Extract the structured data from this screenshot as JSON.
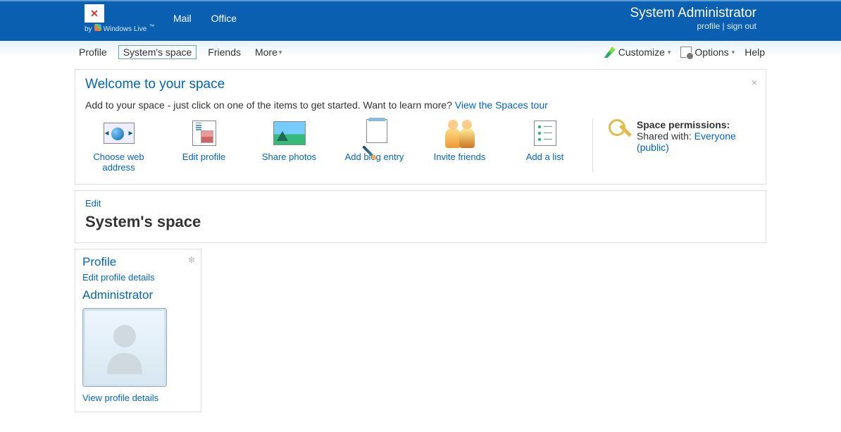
{
  "header": {
    "by": "by",
    "brand": "Windows Live",
    "tm": "™",
    "links": {
      "mail": "Mail",
      "office": "Office"
    },
    "user": {
      "name": "System Administrator",
      "profile": "profile",
      "sep": " | ",
      "signout": "sign out"
    }
  },
  "nav": {
    "profile": "Profile",
    "space": "System's space",
    "friends": "Friends",
    "more": "More",
    "customize": "Customize",
    "options": "Options",
    "help": "Help"
  },
  "welcome": {
    "title": "Welcome to your space",
    "intro": "Add to your space - just click on one of the items to get started. Want to learn more? ",
    "tour": "View the Spaces tour",
    "tiles": {
      "web": "Choose web address",
      "edit": "Edit profile",
      "photos": "Share photos",
      "blog": "Add blog entry",
      "invite": "Invite friends",
      "list": "Add a list"
    },
    "perm": {
      "heading": "Space permissions:",
      "shared": "Shared with: ",
      "value": "Everyone (public)"
    }
  },
  "space": {
    "edit": "Edit",
    "title": "System's space"
  },
  "profileCard": {
    "heading": "Profile",
    "editDetails": "Edit profile details",
    "who": "Administrator",
    "viewDetails": "View profile details"
  }
}
